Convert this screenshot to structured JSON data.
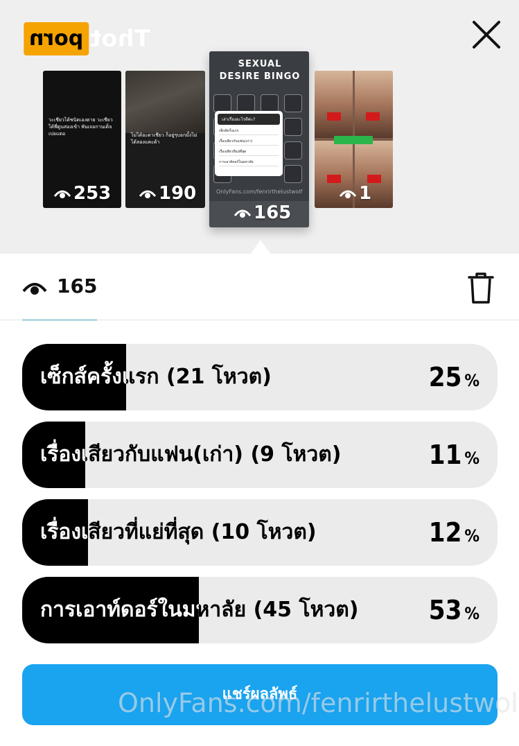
{
  "brand": {
    "logo_box_text": "porn",
    "logo_text": "Thot"
  },
  "stories": [
    {
      "views": "253",
      "caption": "วะเชียวได้ชนิดเองตาย วะเชียวได้พี่ตูนสองเข้า พันเจอกานเด็จเบ่ยแตอ"
    },
    {
      "views": "190",
      "caption": "ไม่ได้อะดาเชียว ก็อยู่ๆบอกมั้งไม่ได้ลองแคะด้า"
    },
    {
      "views": "165",
      "title": "SEXUAL DESIRE BINGO",
      "poll_head": "เล่าเรื่องอะไรดีค่ะ?",
      "poll_rows": [
        "เซ็กส์ครั้งแรก",
        "เรื่องเสียวกับแฟน(เก่า)",
        "เรื่องเสียวที่แย่ที่สุด",
        "การเอาท์ดอร์ในมหาลัย"
      ],
      "url": "OnlyFans.com/fenrirthelustwolf"
    },
    {
      "views": "1"
    }
  ],
  "viewer": {
    "count": "165"
  },
  "poll": {
    "options": [
      {
        "label": "เซ็กส์ครั้งแรก (21 โหวต)",
        "percent": "25",
        "fraction": 0.25
      },
      {
        "label": "เรื่องเสียวกับแฟน(เก่า) (9 โหวต)",
        "percent": "11",
        "fraction": 0.11
      },
      {
        "label": "เรื่องเสียวที่แย่ที่สุด (10 โหวต)",
        "percent": "12",
        "fraction": 0.12
      },
      {
        "label": "การเอาท์ดอร์ในมหาลัย (45 โหวต)",
        "percent": "53",
        "fraction": 0.53
      }
    ],
    "percent_sign": "%"
  },
  "share": {
    "label": "แชร์ผลลัพธ์"
  },
  "watermark": "OnlyFans.com/fenrirthelustwolf",
  "colors": {
    "accent": "#1aa3ef",
    "fill": "#000000",
    "track": "#ebebeb",
    "brand": "#f5a300"
  },
  "icons": {
    "close": "close-icon",
    "eye": "eye-icon",
    "trash": "trash-icon"
  }
}
